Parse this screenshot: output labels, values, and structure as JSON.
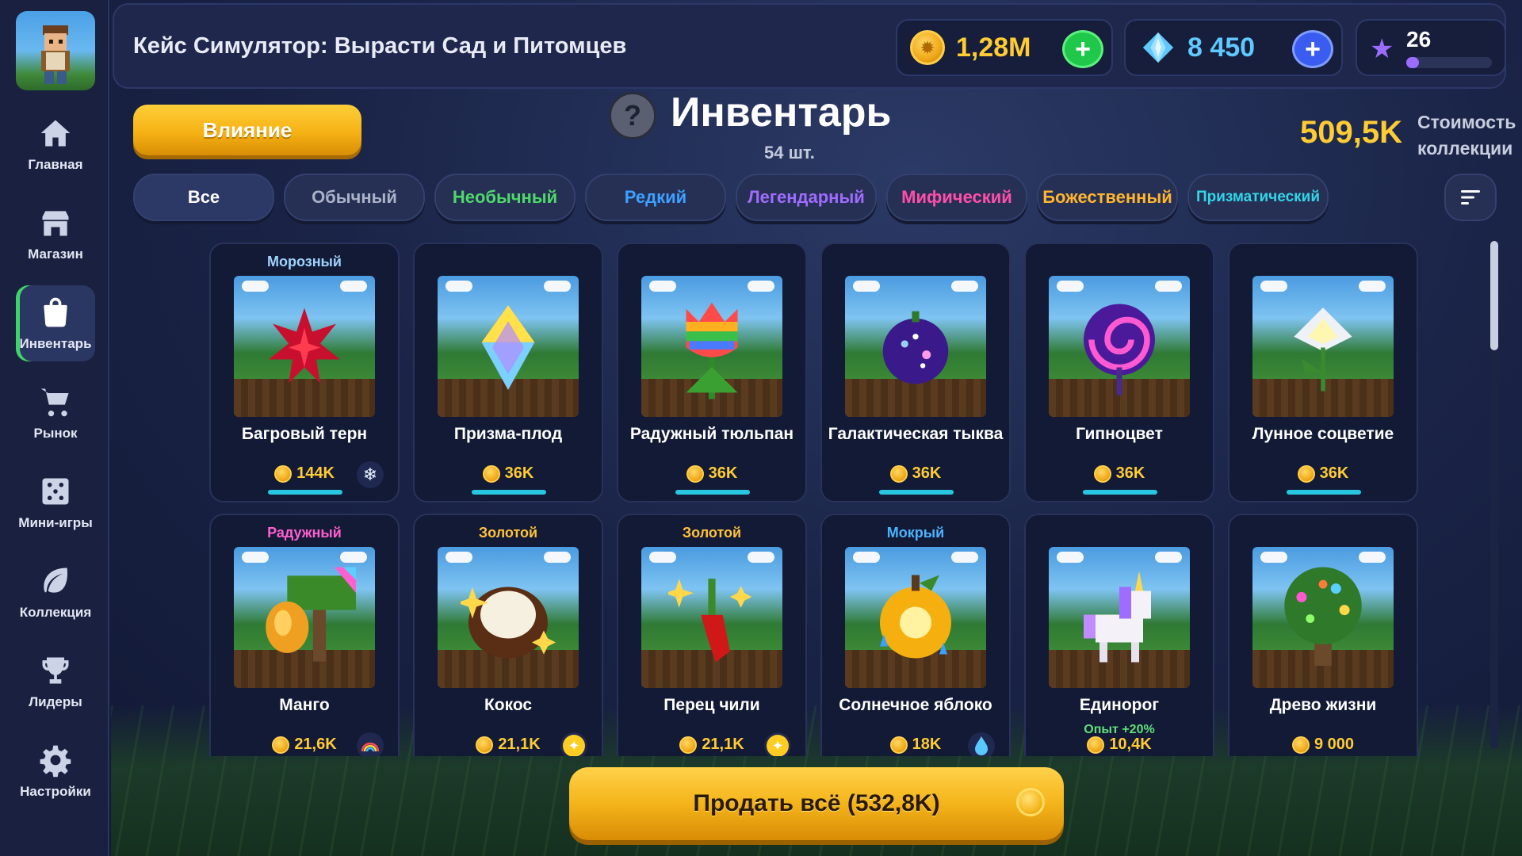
{
  "game_title": "Кейс Симулятор: Вырасти Сад и Питомцев",
  "currencies": {
    "coins": "1,28M",
    "gems": "8 450",
    "level": "26",
    "xp_progress": 0.15
  },
  "sidebar": {
    "items": [
      {
        "label": "Главная",
        "icon": "home-icon"
      },
      {
        "label": "Магазин",
        "icon": "shop-icon"
      },
      {
        "label": "Инвентарь",
        "icon": "bag-icon",
        "active": true
      },
      {
        "label": "Рынок",
        "icon": "cart-icon"
      },
      {
        "label": "Мини-игры",
        "icon": "dice-icon"
      },
      {
        "label": "Коллекция",
        "icon": "leaf-icon"
      },
      {
        "label": "Лидеры",
        "icon": "trophy-icon"
      },
      {
        "label": "Настройки",
        "icon": "gear-icon"
      }
    ]
  },
  "header": {
    "influence_label": "Влияние",
    "help_label": "?",
    "title": "Инвентарь",
    "count": "54 шт.",
    "collection_value": "509,5K",
    "collection_label": "Стоимость коллекции"
  },
  "tabs": [
    {
      "label": "Все",
      "color": "#ffffff",
      "active": true
    },
    {
      "label": "Обычный",
      "color": "#aab2c8"
    },
    {
      "label": "Необычный",
      "color": "#4fd86a"
    },
    {
      "label": "Редкий",
      "color": "#3ea0ff"
    },
    {
      "label": "Легендарный",
      "color": "#a06cff"
    },
    {
      "label": "Мифический",
      "color": "#ff4fa8"
    },
    {
      "label": "Божественный",
      "color": "#ffb52e"
    },
    {
      "label": "Призматический",
      "color": "#33d6e8"
    }
  ],
  "items": [
    {
      "name": "Багровый терн",
      "mutation": "Морозный",
      "mutation_color": "#9fd4ff",
      "price": "144K",
      "mut_icon": "snowflake-icon",
      "art": "thorn"
    },
    {
      "name": "Призма-плод",
      "mutation": "",
      "price": "36K",
      "art": "prism"
    },
    {
      "name": "Радужный тюльпан",
      "mutation": "",
      "price": "36K",
      "art": "tulip"
    },
    {
      "name": "Галактическая тыква",
      "mutation": "",
      "price": "36K",
      "art": "pumpkin"
    },
    {
      "name": "Гипноцвет",
      "mutation": "",
      "price": "36K",
      "art": "hypno"
    },
    {
      "name": "Лунное соцветие",
      "mutation": "",
      "price": "36K",
      "art": "moon"
    },
    {
      "name": "Манго",
      "mutation": "Радужный",
      "mutation_color": "#ff5fd0",
      "price": "21,6K",
      "mut_icon": "rainbow-icon",
      "art": "mango"
    },
    {
      "name": "Кокос",
      "mutation": "Золотой",
      "mutation_color": "#ffc23a",
      "price": "21,1K",
      "mut_icon": "star-coin-icon",
      "art": "coconut"
    },
    {
      "name": "Перец чили",
      "mutation": "Золотой",
      "mutation_color": "#ffc23a",
      "price": "21,1K",
      "mut_icon": "star-coin-icon",
      "art": "chili"
    },
    {
      "name": "Солнечное яблоко",
      "mutation": "Мокрый",
      "mutation_color": "#4ab4ff",
      "price": "18K",
      "mut_icon": "droplet-icon",
      "art": "apple"
    },
    {
      "name": "Единорог",
      "mutation": "",
      "bonus": "Опыт +20%",
      "price": "10,4K",
      "art": "unicorn"
    },
    {
      "name": "Древо жизни",
      "mutation": "",
      "price": "9 000",
      "art": "tree"
    }
  ],
  "sell_all_label": "Продать всё (532,8K)"
}
